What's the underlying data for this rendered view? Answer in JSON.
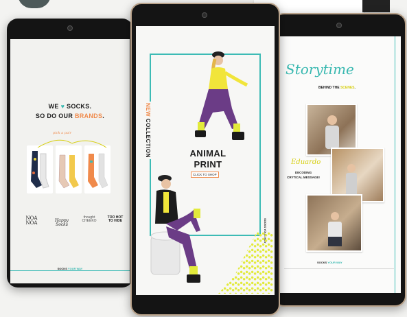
{
  "left_screen": {
    "headline_line1": "WE",
    "headline_heart": "♥",
    "headline_line1_tail": "SOCKS.",
    "headline_line2_pre": "SO DO OUR",
    "headline_line2_accent": "BRANDS",
    "headline_line2_dot": ".",
    "annotation": "pick a pair",
    "brands": [
      {
        "label": "NOA\nNOA"
      },
      {
        "label": "Happy Socks"
      },
      {
        "label": "thought\nCHEEKO"
      },
      {
        "label": "TOO HOT\nTO HIDE"
      }
    ],
    "footer_pre": "SOCKS",
    "footer_accent": "YOUR WAY"
  },
  "mid_screen": {
    "vertical_new": "NEW",
    "vertical_collection": "COLLECTION",
    "title_line1": "ANIMAL",
    "title_line2": "PRINT",
    "cta": "CLICK TO SHOP",
    "side_vertical": "SOCKS YOUR WAY"
  },
  "right_screen": {
    "script_title": "Storytime",
    "subtitle_pre": "BEHIND THE",
    "subtitle_accent": "SCENES",
    "subtitle_dot": ".",
    "script_name": "Eduardo",
    "caption_line1": "DECODING",
    "caption_line2": "CRYTICAL MESSAGE!",
    "footer_pre": "SOCKS",
    "footer_accent": "YOUR WAY"
  },
  "colors": {
    "teal": "#38b8b0",
    "orange": "#f08a4b",
    "yellow": "#d7cf11",
    "purple": "#6b3c86",
    "tablet_frame": "#141414",
    "bezel_gold": "#b9a28a"
  }
}
